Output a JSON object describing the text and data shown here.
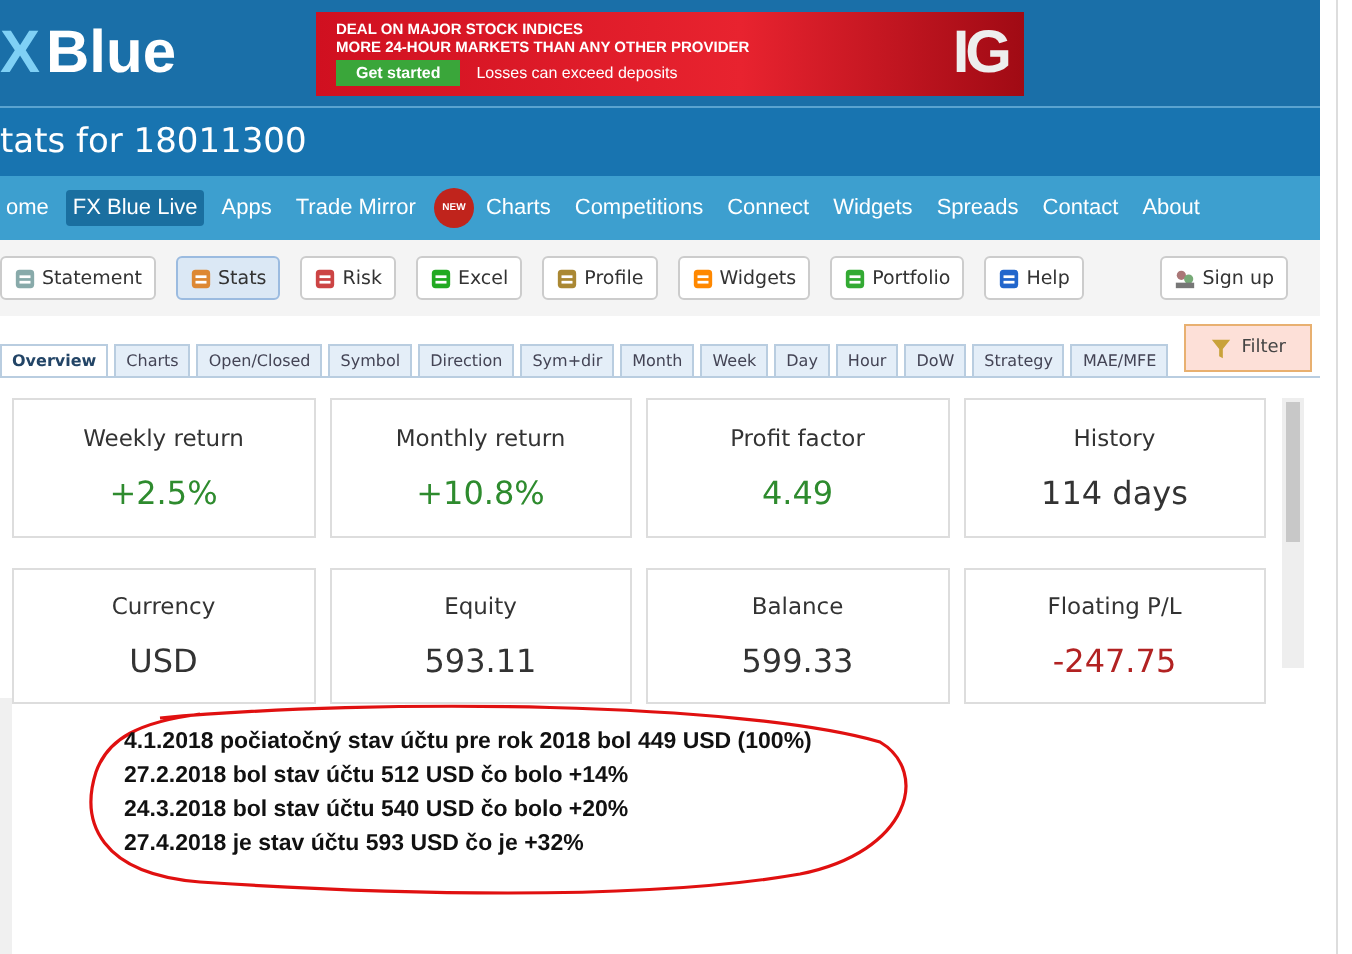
{
  "logo": {
    "mark": "X",
    "word": "Blue"
  },
  "ad": {
    "headline": [
      "DEAL ON MAJOR STOCK INDICES",
      "MORE 24-HOUR MARKETS THAN ANY OTHER PROVIDER"
    ],
    "button": "Get started",
    "disclaimer": "Losses can exceed deposits",
    "brand": "IG"
  },
  "page_title": "tats for 18011300",
  "nav": [
    {
      "label": "ome",
      "selected": false
    },
    {
      "label": "FX Blue Live",
      "selected": true
    },
    {
      "label": "Apps",
      "selected": false
    },
    {
      "label": "Trade Mirror",
      "selected": false
    },
    {
      "label": "Charts",
      "selected": false,
      "badge": "NEW"
    },
    {
      "label": "Competitions",
      "selected": false
    },
    {
      "label": "Connect",
      "selected": false
    },
    {
      "label": "Widgets",
      "selected": false
    },
    {
      "label": "Spreads",
      "selected": false
    },
    {
      "label": "Contact",
      "selected": false
    },
    {
      "label": "About",
      "selected": false
    }
  ],
  "toolbar": [
    {
      "label": "Statement",
      "selected": false
    },
    {
      "label": "Stats",
      "selected": true
    },
    {
      "label": "Risk",
      "selected": false
    },
    {
      "label": "Excel",
      "selected": false
    },
    {
      "label": "Profile",
      "selected": false
    },
    {
      "label": "Widgets",
      "selected": false
    },
    {
      "label": "Portfolio",
      "selected": false
    },
    {
      "label": "Help",
      "selected": false
    }
  ],
  "sign_up": "Sign up",
  "tabs": [
    {
      "label": "Overview",
      "selected": true
    },
    {
      "label": "Charts",
      "selected": false
    },
    {
      "label": "Open/Closed",
      "selected": false
    },
    {
      "label": "Symbol",
      "selected": false
    },
    {
      "label": "Direction",
      "selected": false
    },
    {
      "label": "Sym+dir",
      "selected": false
    },
    {
      "label": "Month",
      "selected": false
    },
    {
      "label": "Week",
      "selected": false
    },
    {
      "label": "Day",
      "selected": false
    },
    {
      "label": "Hour",
      "selected": false
    },
    {
      "label": "DoW",
      "selected": false
    },
    {
      "label": "Strategy",
      "selected": false
    },
    {
      "label": "MAE/MFE",
      "selected": false
    }
  ],
  "filter": "Filter",
  "cards": [
    {
      "label": "Weekly return",
      "value": "+2.5%",
      "color": "#2e8b2e"
    },
    {
      "label": "Monthly return",
      "value": "+10.8%",
      "color": "#2e8b2e"
    },
    {
      "label": "Profit factor",
      "value": "4.49",
      "color": "#2e8b2e"
    },
    {
      "label": "History",
      "value": "114 days",
      "color": "#333333"
    },
    {
      "label": "Currency",
      "value": "USD",
      "color": "#333333"
    },
    {
      "label": "Equity",
      "value": "593.11",
      "color": "#333333"
    },
    {
      "label": "Balance",
      "value": "599.33",
      "color": "#333333"
    },
    {
      "label": "Floating P/L",
      "value": "-247.75",
      "color": "#b22222"
    }
  ],
  "note": [
    "4.1.2018 počiatočný stav účtu pre rok 2018 bol 449 USD (100%)",
    "27.2.2018 bol stav účtu 512 USD čo bolo +14%",
    "24.3.2018 bol stav účtu 540 USD čo bolo +20%",
    "27.4.2018 je stav účtu 593 USD čo je +32%"
  ]
}
